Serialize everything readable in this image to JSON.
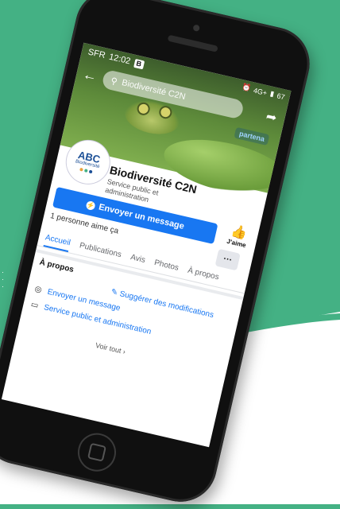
{
  "status_bar": {
    "carrier": "SFR",
    "time": "12:02",
    "badge": "B",
    "network": "4G+",
    "battery": "67"
  },
  "search": {
    "placeholder": "Biodiversité C2N"
  },
  "cover": {
    "partner_logo": "partena"
  },
  "profile": {
    "logo_text": "ABC",
    "logo_subtext": "Biodiversité",
    "name": "Biodiversité C2N",
    "category": "Service public et administration"
  },
  "actions": {
    "message_label": "Envoyer un message",
    "like_label": "J'aime",
    "more_label": "···"
  },
  "likes": {
    "text": "1 personne aime ça"
  },
  "tabs": [
    {
      "label": "Accueil",
      "active": true
    },
    {
      "label": "Publications"
    },
    {
      "label": "Avis"
    },
    {
      "label": "Photos"
    },
    {
      "label": "À propos"
    }
  ],
  "about": {
    "title": "À propos",
    "suggest_label": "Suggérer des modifications",
    "rows": [
      {
        "icon": "messenger-icon",
        "label": "Envoyer un message"
      },
      {
        "icon": "category-icon",
        "label": "Service public et administration"
      }
    ],
    "see_all": "Voir tout"
  },
  "colors": {
    "background": "#44b184",
    "accent": "#1877f2",
    "logo_blue": "#1b4f96"
  }
}
